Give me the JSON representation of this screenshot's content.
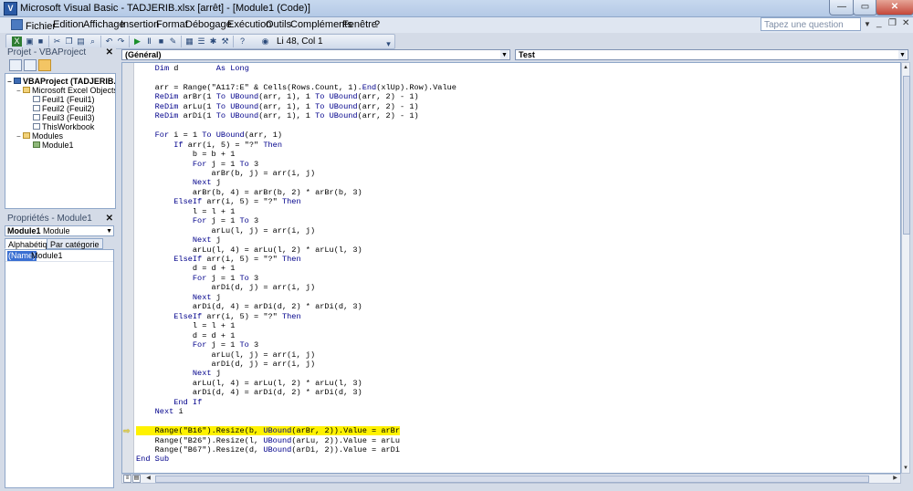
{
  "window": {
    "title": "Microsoft Visual Basic - TADJERIB.xlsx [arrêt] - [Module1 (Code)]",
    "minimize_glyph": "—",
    "maximize_glyph": "▭",
    "close_glyph": "✕"
  },
  "menu": {
    "items": [
      "Fichier",
      "Edition",
      "Affichage",
      "Insertion",
      "Format",
      "Débogage",
      "Exécution",
      "Outils",
      "Compléments",
      "Fenêtre",
      "?"
    ],
    "help_placeholder": "Tapez une question",
    "child_min": "_",
    "child_restore": "❐",
    "child_close": "✕"
  },
  "toolbar": {
    "position": "Li 48, Col 1"
  },
  "project_explorer": {
    "title": "Projet - VBAProject",
    "close": "✕",
    "nodes": [
      {
        "label": "VBAProject (TADJERIB.xlsx)",
        "toggle": "−",
        "icon": "vba",
        "bold": true
      },
      {
        "label": "Microsoft Excel Objects",
        "toggle": "−",
        "icon": "folder",
        "bold": false
      },
      {
        "label": "Feuil1 (Feuil1)",
        "toggle": "",
        "icon": "sheet",
        "bold": false
      },
      {
        "label": "Feuil2 (Feuil2)",
        "toggle": "",
        "icon": "sheet",
        "bold": false
      },
      {
        "label": "Feuil3 (Feuil3)",
        "toggle": "",
        "icon": "sheet",
        "bold": false
      },
      {
        "label": "ThisWorkbook",
        "toggle": "",
        "icon": "sheet",
        "bold": false
      },
      {
        "label": "Modules",
        "toggle": "−",
        "icon": "folder",
        "bold": false
      },
      {
        "label": "Module1",
        "toggle": "",
        "icon": "mod",
        "bold": false
      }
    ]
  },
  "properties": {
    "title": "Propriétés - Module1",
    "close": "✕",
    "object_name": "Module1",
    "object_type": "Module",
    "tabs": [
      "Alphabétique",
      "Par catégorie"
    ],
    "rows": [
      {
        "name": "(Name)",
        "value": "Module1"
      }
    ]
  },
  "code_window": {
    "object_combo": "(Général)",
    "proc_combo": "Test",
    "exec_line_index": 38,
    "lines": [
      "    Dim d        As Long",
      "",
      "    arr = Range(\"A117:E\" & Cells(Rows.Count, 1).End(xlUp).Row).Value",
      "    ReDim arBr(1 To UBound(arr, 1), 1 To UBound(arr, 2) - 1)",
      "    ReDim arLu(1 To UBound(arr, 1), 1 To UBound(arr, 2) - 1)",
      "    ReDim arDi(1 To UBound(arr, 1), 1 To UBound(arr, 2) - 1)",
      "",
      "    For i = 1 To UBound(arr, 1)",
      "        If arr(i, 5) = \"?\" Then",
      "            b = b + 1",
      "            For j = 1 To 3",
      "                arBr(b, j) = arr(i, j)",
      "            Next j",
      "            arBr(b, 4) = arBr(b, 2) * arBr(b, 3)",
      "        ElseIf arr(i, 5) = \"?\" Then",
      "            l = l + 1",
      "            For j = 1 To 3",
      "                arLu(l, j) = arr(i, j)",
      "            Next j",
      "            arLu(l, 4) = arLu(l, 2) * arLu(l, 3)",
      "        ElseIf arr(i, 5) = \"?\" Then",
      "            d = d + 1",
      "            For j = 1 To 3",
      "                arDi(d, j) = arr(i, j)",
      "            Next j",
      "            arDi(d, 4) = arDi(d, 2) * arDi(d, 3)",
      "        ElseIf arr(i, 5) = \"?\" Then",
      "            l = l + 1",
      "            d = d + 1",
      "            For j = 1 To 3",
      "                arLu(l, j) = arr(i, j)",
      "                arDi(d, j) = arr(i, j)",
      "            Next j",
      "            arLu(l, 4) = arLu(l, 2) * arLu(l, 3)",
      "            arDi(d, 4) = arDi(d, 2) * arDi(d, 3)",
      "        End If",
      "    Next i",
      "",
      "    Range(\"B16\").Resize(b, UBound(arBr, 2)).Value = arBr",
      "    Range(\"B26\").Resize(l, UBound(arLu, 2)).Value = arLu",
      "    Range(\"B67\").Resize(d, UBound(arDi, 2)).Value = arDi",
      "End Sub"
    ],
    "keywords": [
      "Dim",
      "As",
      "Long",
      "ReDim",
      "To",
      "For",
      "If",
      "Then",
      "ElseIf",
      "Next",
      "End",
      "Sub",
      "UBound"
    ]
  },
  "colors": {
    "keyword": "#00008b",
    "highlight": "#fff200",
    "accent": "#3a6fd2"
  }
}
